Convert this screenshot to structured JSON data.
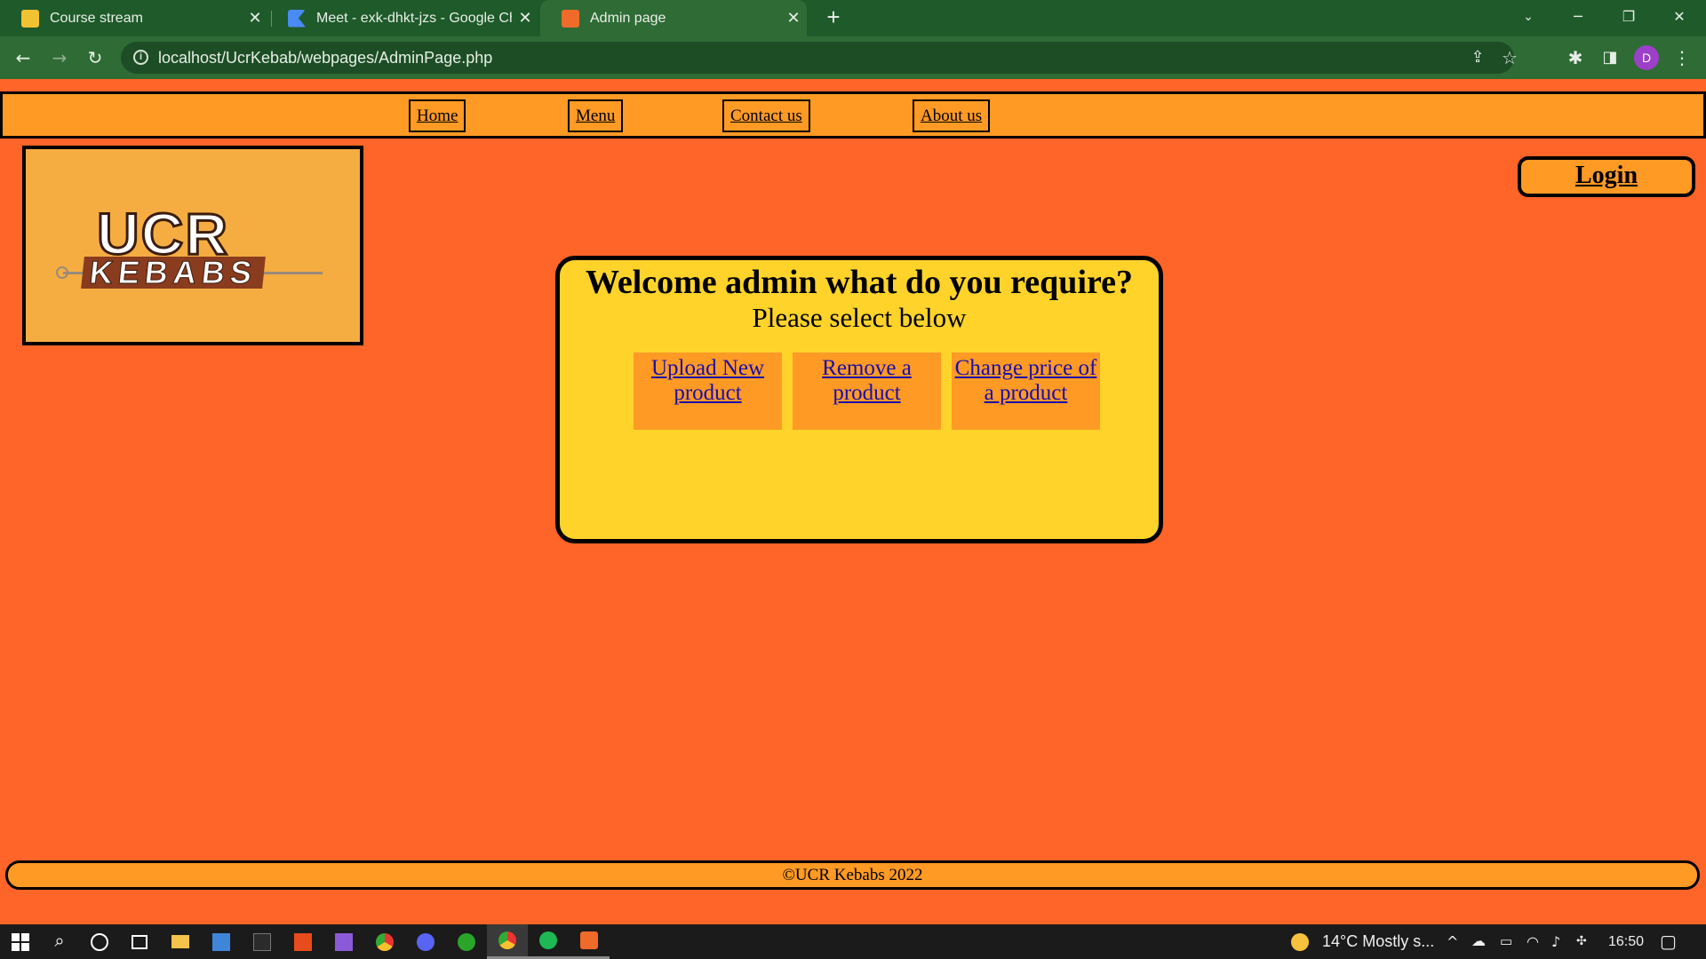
{
  "browser": {
    "tabs": [
      {
        "title": "Course stream",
        "favicon": "classroom-icon",
        "color": "#f2c331",
        "active": false
      },
      {
        "title": "Meet - exk-dhkt-jzs - Google Chr",
        "favicon": "meet-icon",
        "color": "#4a8af4",
        "active": false
      },
      {
        "title": "Admin page",
        "favicon": "xampp-icon",
        "color": "#f06a2a",
        "active": true
      }
    ],
    "new_tab": "+",
    "url": "localhost/UcrKebab/webpages/AdminPage.php",
    "profile_initial": "D",
    "profile_color": "#9c3fc9",
    "theme_color": "#2f6b35"
  },
  "nav": {
    "items": [
      {
        "label": "Home"
      },
      {
        "label": "Menu"
      },
      {
        "label": "Contact us"
      },
      {
        "label": "About us"
      }
    ]
  },
  "logo": {
    "line1": "UCR",
    "line2": "KEBABS"
  },
  "login_label": "Login",
  "panel": {
    "heading": "Welcome admin what do you require?",
    "subheading": "Please select below",
    "options": [
      {
        "label": "Upload New product"
      },
      {
        "label": "Remove a product"
      },
      {
        "label": "Change price of a product"
      }
    ]
  },
  "footer": {
    "text": "©UCR Kebabs 2022"
  },
  "colors": {
    "page_bg": "#ff6428",
    "nav_bg": "#ff9a25",
    "panel_bg": "#ffd32a",
    "link": "#1a0dab"
  },
  "taskbar": {
    "weather": "14°C  Mostly s...",
    "time": "16:50"
  }
}
